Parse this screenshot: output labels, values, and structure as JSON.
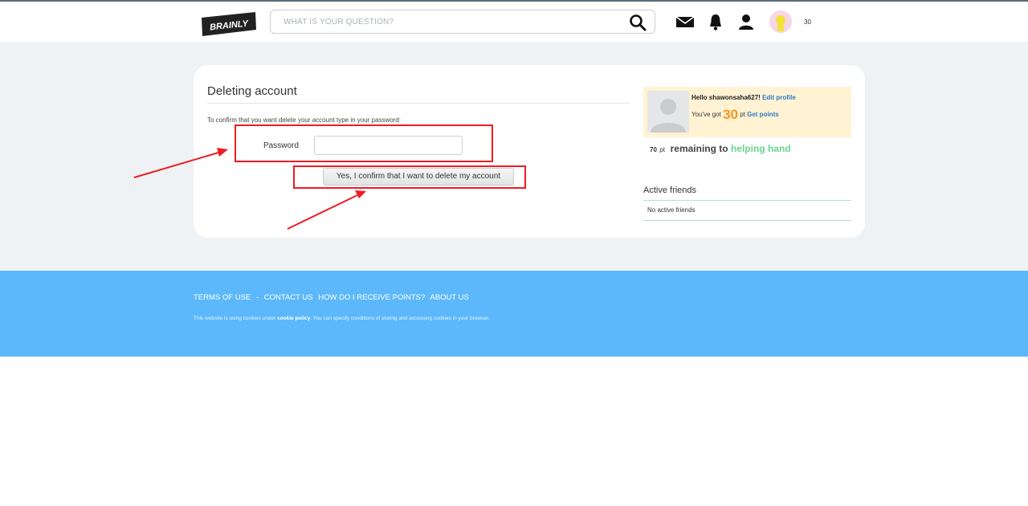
{
  "header": {
    "logo_text": "BRAINLY",
    "search_placeholder": "WHAT IS YOUR QUESTION?",
    "icons": [
      "search-icon",
      "mail-icon",
      "bell-icon",
      "user-icon"
    ],
    "points": "30"
  },
  "main": {
    "title": "Deleting account",
    "confirm_text": "To confirm that you want delete your account type in your password:",
    "password_label": "Password",
    "password_value": "",
    "confirm_button": "Yes, I confirm that I want to delete my account"
  },
  "sidebar": {
    "hello": "Hello shawonsaha627!",
    "edit_profile": "Edit profile",
    "got_prefix": "You've got",
    "got_points": "30",
    "got_unit": "pt",
    "get_points": "Get points",
    "remaining_points": "70",
    "remaining_unit": "pt",
    "remaining_text": "remaining to",
    "helping_hand": "helping hand",
    "active_friends_title": "Active friends",
    "active_friends_empty": "No active friends"
  },
  "footer": {
    "links": [
      "TERMS OF USE",
      "-",
      "CONTACT US",
      "HOW DO I RECEIVE POINTS?",
      "ABOUT US"
    ],
    "cookie_pre": "This website is using cookies under",
    "cookie_link": "cookie policy",
    "cookie_post": ". You can specify conditions of storing and accessing cookies in your browser."
  },
  "colors": {
    "accent_blue": "#5cb8fb",
    "annotation_red": "#ee1c24",
    "points_orange": "#f6931d",
    "helping_green": "#6bd491",
    "link_blue": "#2e79c8"
  }
}
